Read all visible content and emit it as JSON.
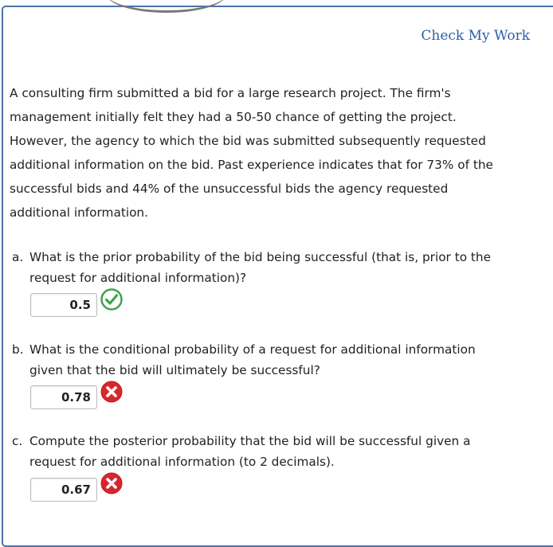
{
  "header": {
    "check_my_work": "Check My Work"
  },
  "intro": {
    "lines": [
      "A consulting firm submitted a bid for a large research project. The firm's",
      "management initially felt they had a 50-50 chance of getting the project.",
      "However, the agency to which the bid was submitted subsequently requested",
      "additional information on the bid. Past experience indicates that for 73% of the",
      "successful bids and 44% of the unsuccessful bids the agency requested",
      "additional information."
    ]
  },
  "questions": [
    {
      "letter": "a.",
      "line1": "What is the prior probability of the bid being successful (that is, prior to the",
      "line2": "request for additional information)?",
      "answer": "0.5",
      "status": "correct",
      "status_icon": "check-circle-icon"
    },
    {
      "letter": "b.",
      "line1": "What is the conditional probability of a request for additional information",
      "line2": "given that the bid will ultimately be successful?",
      "answer": "0.78",
      "status": "incorrect",
      "status_icon": "x-circle-icon"
    },
    {
      "letter": "c.",
      "line1": "Compute the posterior probability that the bid will be successful given a",
      "line2": "request for additional information (to 2 decimals).",
      "answer": "0.67",
      "status": "incorrect",
      "status_icon": "x-circle-icon"
    }
  ],
  "colors": {
    "link": "#2b5fa8",
    "frame": "#4a73a8",
    "correct": "#3fa34d",
    "incorrect": "#d8262d"
  }
}
